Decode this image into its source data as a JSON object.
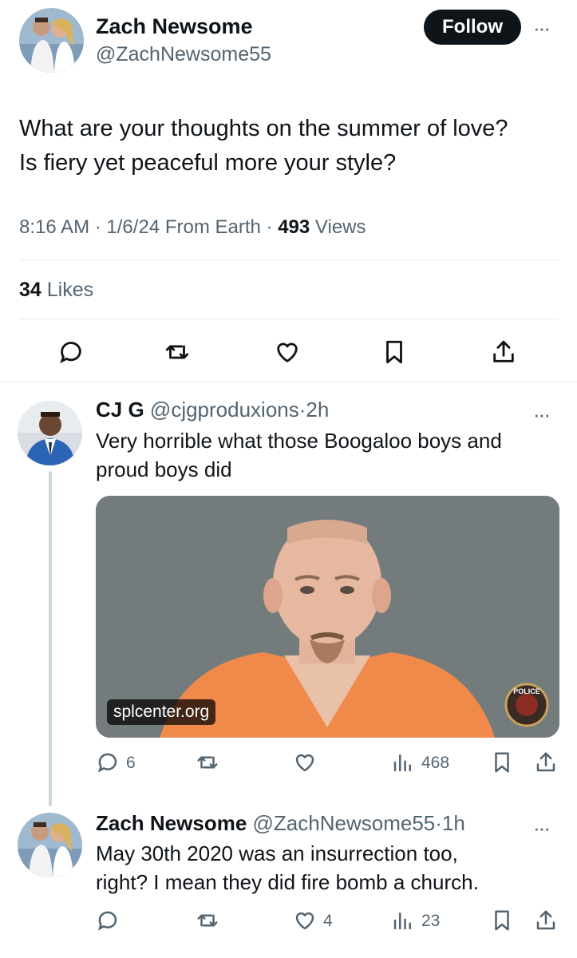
{
  "tweet": {
    "author_name": "Zach Newsome",
    "author_handle": "@ZachNewsome55",
    "follow_label": "Follow",
    "more_label": "···",
    "text_line1": "What are your thoughts on the summer of love?",
    "text_line2": "Is fiery yet peaceful more your style?",
    "time": "8:16 AM",
    "date": "1/6/24",
    "source": "From Earth",
    "separator": "·",
    "views_count": "493",
    "views_label": "Views",
    "likes_count": "34",
    "likes_label": "Likes",
    "actions": [
      "reply-icon",
      "retweet-icon",
      "like-icon",
      "bookmark-icon",
      "share-icon"
    ]
  },
  "replies": [
    {
      "name": "CJ G",
      "handle": "@cjgproduxions",
      "time": "2h",
      "text_line1": "Very horrible what those Boogaloo boys and",
      "text_line2": "proud boys did",
      "media_source": "splcenter.org",
      "media_badge_text": "POLICE",
      "reply_count": "6",
      "retweet_count": "",
      "like_count": "",
      "view_count": "468"
    },
    {
      "name": "Zach Newsome",
      "handle": "@ZachNewsome55",
      "time": "1h",
      "text_line1": "May 30th 2020 was an insurrection too,",
      "text_line2": "right?  I mean they did fire bomb a church.",
      "reply_count": "",
      "retweet_count": "",
      "like_count": "4",
      "view_count": "23"
    }
  ],
  "colors": {
    "text": "#0f1419",
    "secondary": "#536471",
    "divider": "#e6e9ec",
    "thread_line": "#cfd9de",
    "follow_bg": "#0f1419",
    "mugshot_bg": "#6f7778",
    "jumpsuit": "#f08a4b"
  }
}
